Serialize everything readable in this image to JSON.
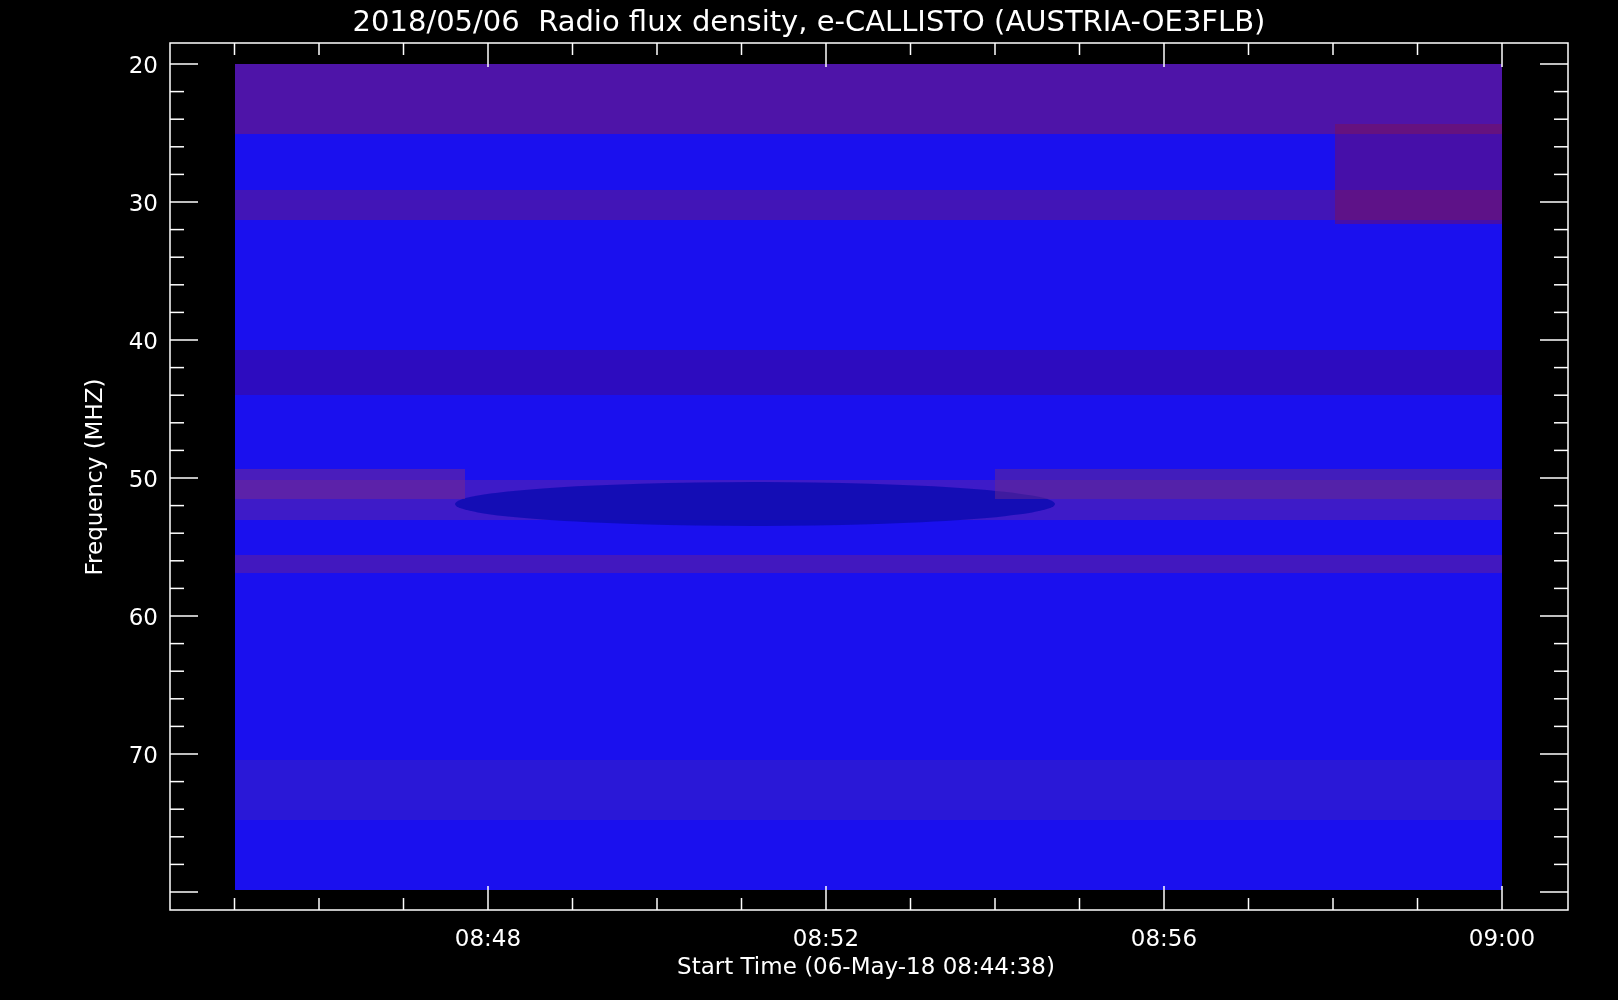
{
  "title": "2018/05/06  Radio flux density, e-CALLISTO (AUSTRIA-OE3FLB)",
  "y_axis": {
    "label": "Frequency (MHZ)",
    "ticks": [
      "20",
      "30",
      "40",
      "50",
      "60",
      "70"
    ]
  },
  "x_axis": {
    "label": "Start Time (06-May-18 08:44:38)",
    "ticks": [
      "08:48",
      "08:52",
      "08:56",
      "09:00"
    ]
  }
}
